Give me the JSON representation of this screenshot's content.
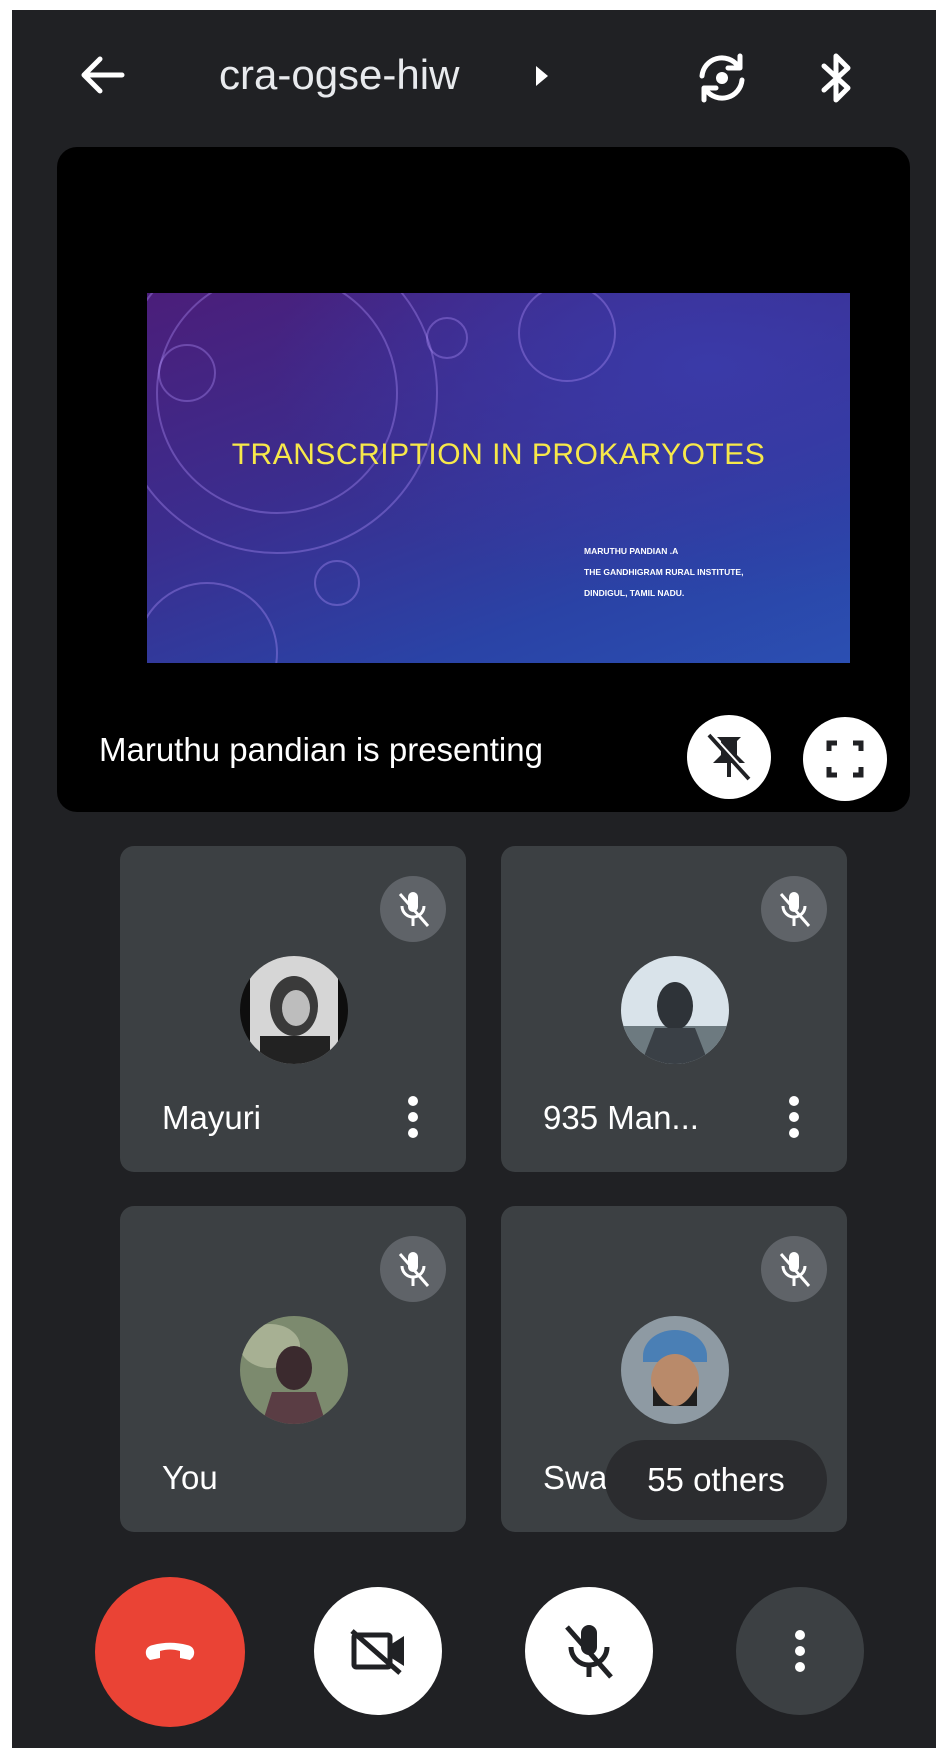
{
  "header": {
    "meeting_code": "cra-ogse-hiw",
    "back_icon": "arrow-left-icon",
    "expand_icon": "caret-right-icon",
    "switch_camera_icon": "switch-camera-icon",
    "audio_output_icon": "bluetooth-icon"
  },
  "presentation": {
    "slide_title": "TRANSCRIPTION IN PROKARYOTES",
    "slide_author_lines": [
      "MARUTHU PANDIAN .A",
      "THE GANDHIGRAM RURAL INSTITUTE,",
      "DINDIGUL, TAMIL NADU."
    ],
    "presenting_text": "Maruthu pandian is presenting",
    "unpin_icon": "unpin-icon",
    "fullscreen_icon": "fullscreen-icon"
  },
  "participants": [
    {
      "name": "Mayuri",
      "muted": true,
      "more_icon": "more-vert-icon"
    },
    {
      "name": "935 Man...",
      "muted": true,
      "more_icon": "more-vert-icon"
    },
    {
      "name": "You",
      "muted": true
    },
    {
      "name": "Swa",
      "muted": true
    }
  ],
  "others_label": "55 others",
  "controls": {
    "end_call_icon": "call-end-icon",
    "camera_icon": "camera-off-icon",
    "mic_icon": "mic-off-icon",
    "more_icon": "more-vert-icon"
  },
  "colors": {
    "background": "#202124",
    "tile": "#3c4043",
    "end_call": "#ea4335",
    "slide_title": "#f7e84a"
  }
}
